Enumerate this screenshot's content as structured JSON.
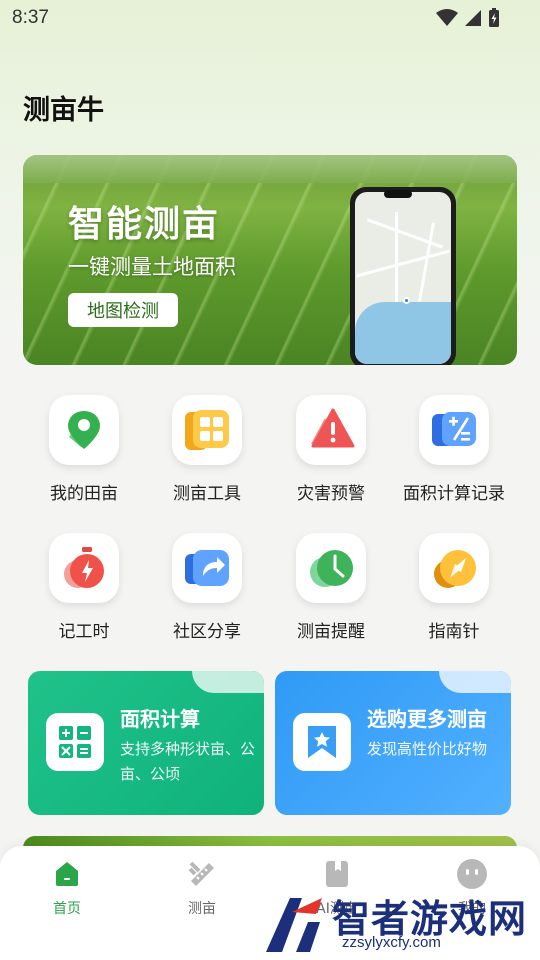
{
  "status": {
    "time": "8:37"
  },
  "app": {
    "title": "测亩牛"
  },
  "banner": {
    "title": "智能测亩",
    "subtitle": "一键测量土地面积",
    "button": "地图检测"
  },
  "grid": [
    {
      "label": "我的田亩",
      "icon": "map-pin-icon",
      "color": "#3fb35a"
    },
    {
      "label": "测亩工具",
      "icon": "grid-tiles-icon",
      "color": "#f2a81d"
    },
    {
      "label": "灾害预警",
      "icon": "warning-triangle-icon",
      "color": "#f05a5a"
    },
    {
      "label": "面积计算记录",
      "icon": "calculator-icon",
      "color": "#3a86f0"
    },
    {
      "label": "记工时",
      "icon": "stopwatch-icon",
      "color": "#f0524a"
    },
    {
      "label": "社区分享",
      "icon": "share-icon",
      "color": "#3a86f0"
    },
    {
      "label": "测亩提醒",
      "icon": "clock-icon",
      "color": "#3fb35a"
    },
    {
      "label": "指南针",
      "icon": "compass-icon",
      "color": "#f2a81d"
    }
  ],
  "cards": [
    {
      "title": "面积计算",
      "desc": "支持多种形状亩、公亩、公顷",
      "icon": "calculator-icon",
      "color": "#12b67e"
    },
    {
      "title": "选购更多测亩",
      "desc": "发现高性价比好物",
      "icon": "bookmark-star-icon",
      "color": "#3a9ef7"
    }
  ],
  "nav": [
    {
      "label": "首页",
      "icon": "home-icon",
      "active": true
    },
    {
      "label": "测亩",
      "icon": "ruler-icon",
      "active": false
    },
    {
      "label": "AI测亩",
      "icon": "book-icon",
      "active": false
    },
    {
      "label": "我的",
      "icon": "face-icon",
      "active": false
    }
  ],
  "watermark": {
    "text": "智者游戏网",
    "url": "zzsylyxcfy.com"
  }
}
